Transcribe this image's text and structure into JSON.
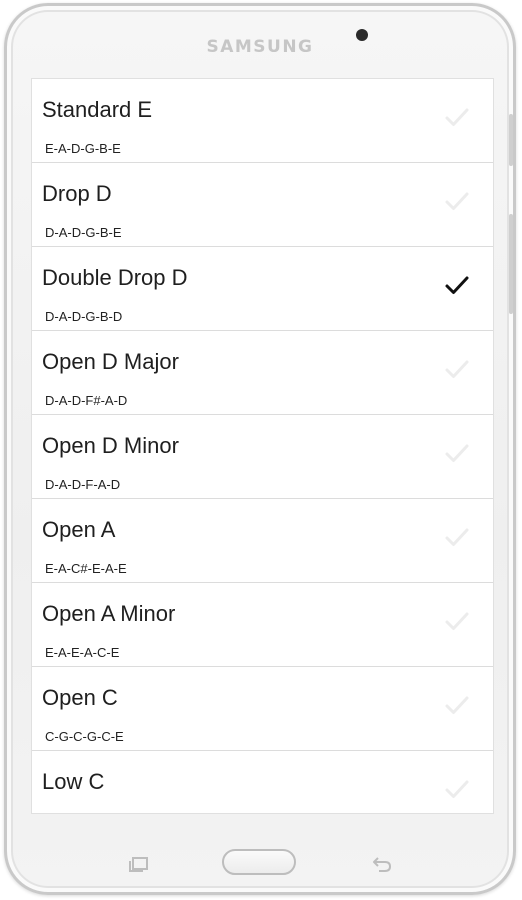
{
  "device": {
    "brand": "SAMSUNG"
  },
  "tunings": [
    {
      "name": "Standard E",
      "notes": "E-A-D-G-B-E",
      "selected": false
    },
    {
      "name": "Drop D",
      "notes": "D-A-D-G-B-E",
      "selected": false
    },
    {
      "name": "Double Drop D",
      "notes": "D-A-D-G-B-D",
      "selected": true
    },
    {
      "name": "Open D Major",
      "notes": "D-A-D-F#-A-D",
      "selected": false
    },
    {
      "name": "Open D Minor",
      "notes": "D-A-D-F-A-D",
      "selected": false
    },
    {
      "name": "Open A",
      "notes": "E-A-C#-E-A-E",
      "selected": false
    },
    {
      "name": "Open A Minor",
      "notes": "E-A-E-A-C-E",
      "selected": false
    },
    {
      "name": "Open C",
      "notes": "C-G-C-G-C-E",
      "selected": false
    },
    {
      "name": "Low C",
      "notes": "",
      "selected": false
    }
  ],
  "colors": {
    "checked": "#111111",
    "unchecked": "#ececec"
  },
  "icons": {
    "check": "checkmark-icon",
    "recent": "recent-apps-icon",
    "home": "home-button",
    "back": "back-icon"
  }
}
